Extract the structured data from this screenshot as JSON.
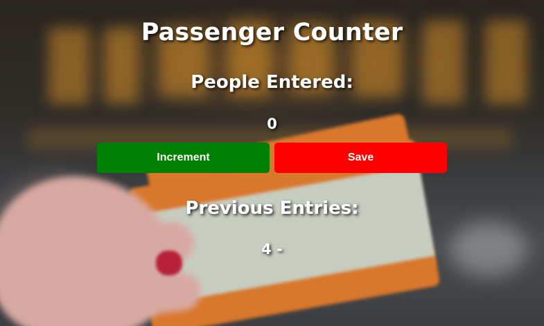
{
  "app": {
    "title": "Passenger Counter",
    "entered_label": "People Entered:",
    "count": "0",
    "previous_label": "Previous Entries:",
    "previous_entries": "4 -"
  },
  "buttons": {
    "increment_label": "Increment",
    "save_label": "Save"
  },
  "colors": {
    "increment": "#008000",
    "save": "#ff0000",
    "text": "#ffffff"
  }
}
